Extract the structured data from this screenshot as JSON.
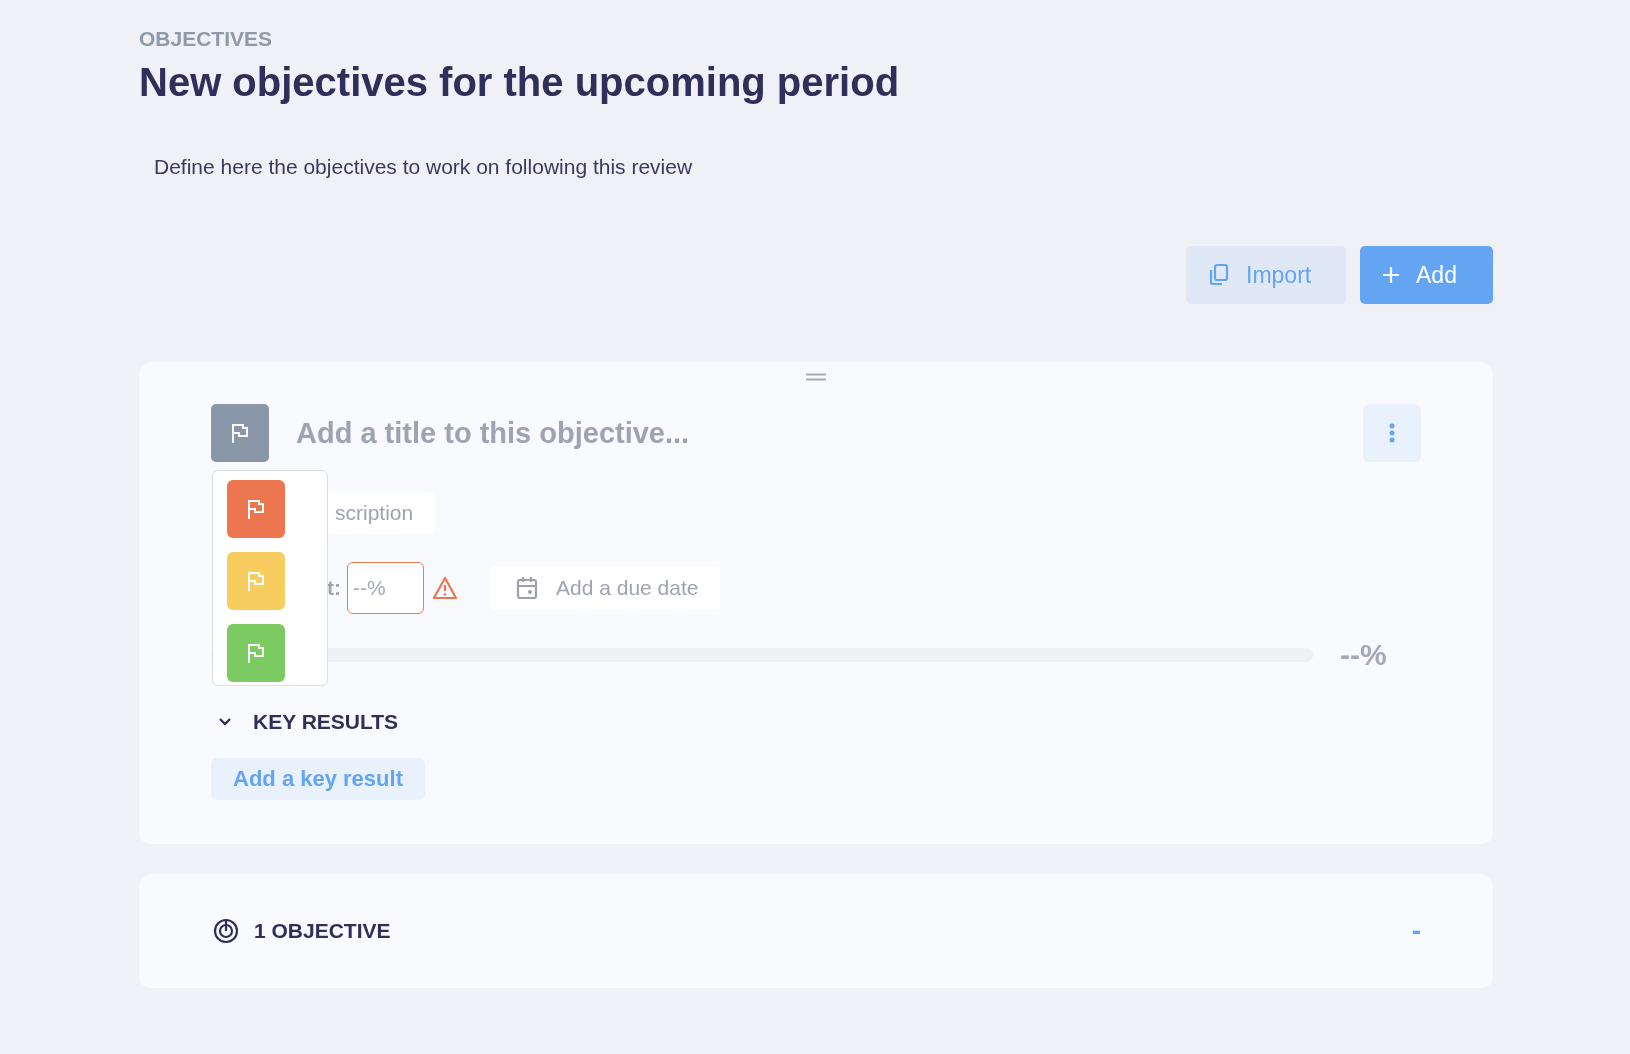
{
  "header": {
    "eyebrow": "OBJECTIVES",
    "title": "New objectives for the upcoming period",
    "description": "Define here the objectives to work on following this review"
  },
  "actions": [
    {
      "label": "Import",
      "kind": "secondary"
    },
    {
      "label": "Add",
      "kind": "primary"
    }
  ],
  "objective": {
    "title_placeholder": "Add a title to this objective...",
    "flag_menu": {
      "open": true,
      "options": [
        {
          "color": "#ec7650"
        },
        {
          "color": "#f6cd5e"
        },
        {
          "color": "#7ccb62"
        }
      ]
    },
    "description_placeholder": "scription",
    "progress_label": "t:",
    "progress_input": {
      "placeholder": "--%",
      "invalid": true
    },
    "due_date": "Add a due date",
    "level": 0,
    "progress_reading": "--%",
    "key_results": {
      "label": "KEY RESULTS",
      "expanded": true,
      "add": "Add a key result"
    }
  },
  "summary": {
    "count": "1 OBJECTIVE",
    "value": "-"
  }
}
